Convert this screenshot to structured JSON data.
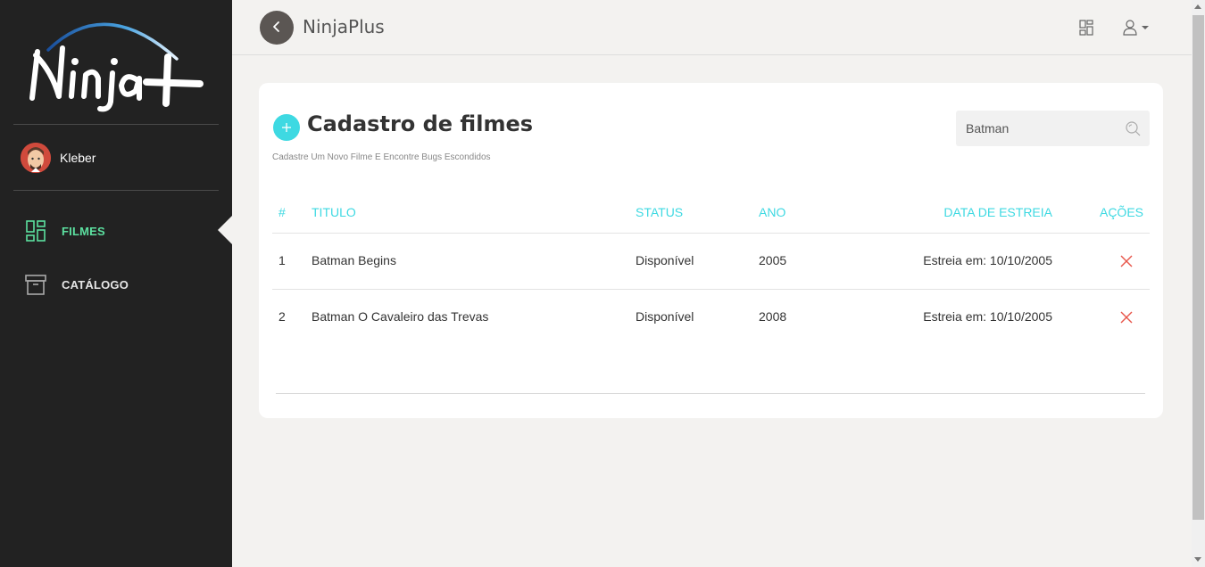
{
  "sidebar": {
    "logo_text": "Ninja+",
    "user": {
      "name": "Kleber"
    },
    "items": [
      {
        "label": "FILMES",
        "icon": "dashboard-icon",
        "active": true
      },
      {
        "label": "CATÁLOGO",
        "icon": "archive-icon",
        "active": false
      }
    ]
  },
  "header": {
    "title": "NinjaPlus",
    "icons": [
      "grid-icon",
      "user-icon",
      "caret-down-icon"
    ]
  },
  "main": {
    "title": "Cadastro de filmes",
    "subtitle": "Cadastre Um Novo Filme E Encontre Bugs Escondidos",
    "search": {
      "value": "Batman",
      "placeholder": ""
    },
    "table": {
      "headers": [
        "#",
        "TITULO",
        "STATUS",
        "ANO",
        "DATA DE ESTREIA",
        "AÇÕES"
      ],
      "rows": [
        {
          "num": "1",
          "title": "Batman Begins",
          "status": "Disponível",
          "year": "2005",
          "release": "Estreia em: 10/10/2005"
        },
        {
          "num": "2",
          "title": "Batman O Cavaleiro das Trevas",
          "status": "Disponível",
          "year": "2008",
          "release": "Estreia em: 10/10/2005"
        }
      ]
    }
  },
  "colors": {
    "sidebar_bg": "#222222",
    "accent": "#3ed9e2",
    "active_nav": "#5ce0a0",
    "delete": "#e8564b"
  }
}
